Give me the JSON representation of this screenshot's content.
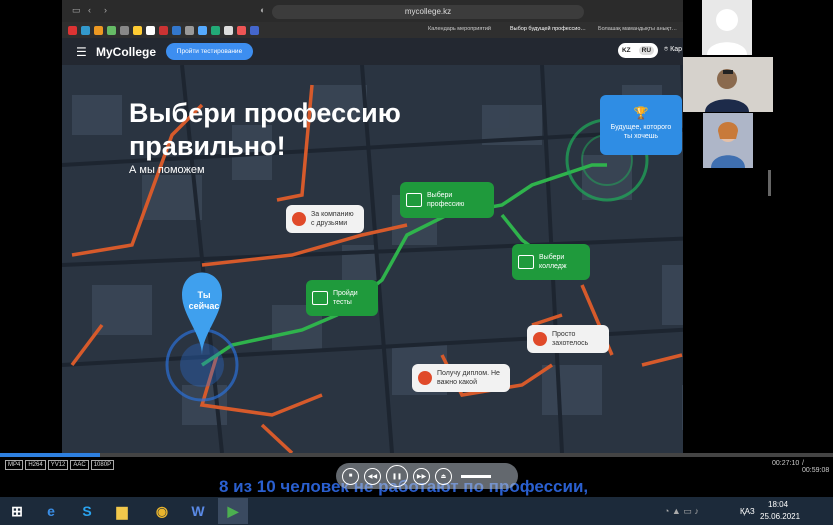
{
  "browser": {
    "url": "mycollege.kz",
    "tabs": [
      "Календарь мероприятий",
      "Выбор будущей профессио…",
      "Болашақ мамандықты анықт…"
    ]
  },
  "site": {
    "brand": "MyCollege",
    "test_button": "Пройти тестирование",
    "langs": [
      "KZ",
      "RU"
    ],
    "active_lang": "RU",
    "city": "Кар"
  },
  "hero": {
    "title": "Выбери профессию правильно!",
    "subtitle": "А мы поможем",
    "pin_label": "Ты сейчас",
    "bubbles": {
      "friends": "За компанию с друзьями",
      "choose_profession": "Выбери профессию",
      "tests": "Пройди тесты",
      "choose_college": "Выбери колледж",
      "future": "Будущее, которого ты хочешь",
      "just_agreed": "Просто захотелось",
      "diploma": "Получу диплом. Не важно какой"
    }
  },
  "player": {
    "codec_tags": [
      "MP4",
      "H264",
      "YV12",
      "AAC",
      "1080P"
    ],
    "progress": 0.12,
    "current_time": "00:27:10",
    "total_time": "/ 00:59:08",
    "subtitle": "8 из 10 человек не работают по профессии,"
  },
  "taskbar": {
    "lang": "ҚАЗ",
    "time": "18:04",
    "date": "25.06.2021"
  },
  "colors": {
    "accent_blue": "#2f8de4",
    "route_green": "#1f9a3c",
    "route_orange": "#d65a2b"
  }
}
